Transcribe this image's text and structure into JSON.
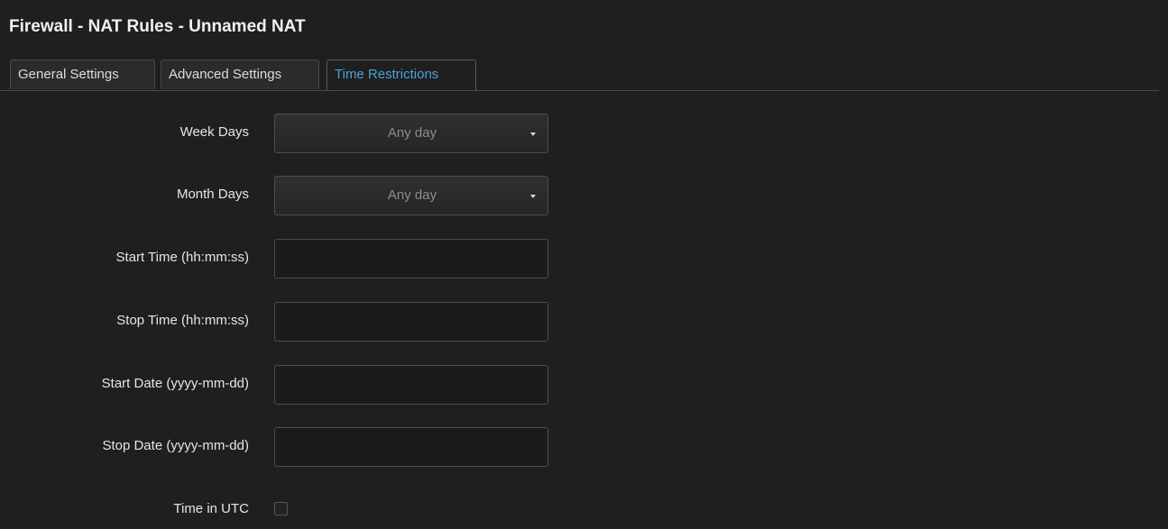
{
  "header": {
    "title": "Firewall - NAT Rules - Unnamed NAT"
  },
  "tabs": [
    {
      "label": "General Settings",
      "active": false
    },
    {
      "label": "Advanced Settings",
      "active": false
    },
    {
      "label": "Time Restrictions",
      "active": true
    }
  ],
  "form": {
    "week_days": {
      "label": "Week Days",
      "value": "Any day"
    },
    "month_days": {
      "label": "Month Days",
      "value": "Any day"
    },
    "start_time": {
      "label": "Start Time (hh:mm:ss)",
      "value": ""
    },
    "stop_time": {
      "label": "Stop Time (hh:mm:ss)",
      "value": ""
    },
    "start_date": {
      "label": "Start Date (yyyy-mm-dd)",
      "value": ""
    },
    "stop_date": {
      "label": "Stop Date (yyyy-mm-dd)",
      "value": ""
    },
    "time_in_utc": {
      "label": "Time in UTC",
      "checked": false
    }
  },
  "colors": {
    "background": "#1f1f1f",
    "active_tab_text": "#4aa3d8",
    "border": "#4d4d4d"
  }
}
